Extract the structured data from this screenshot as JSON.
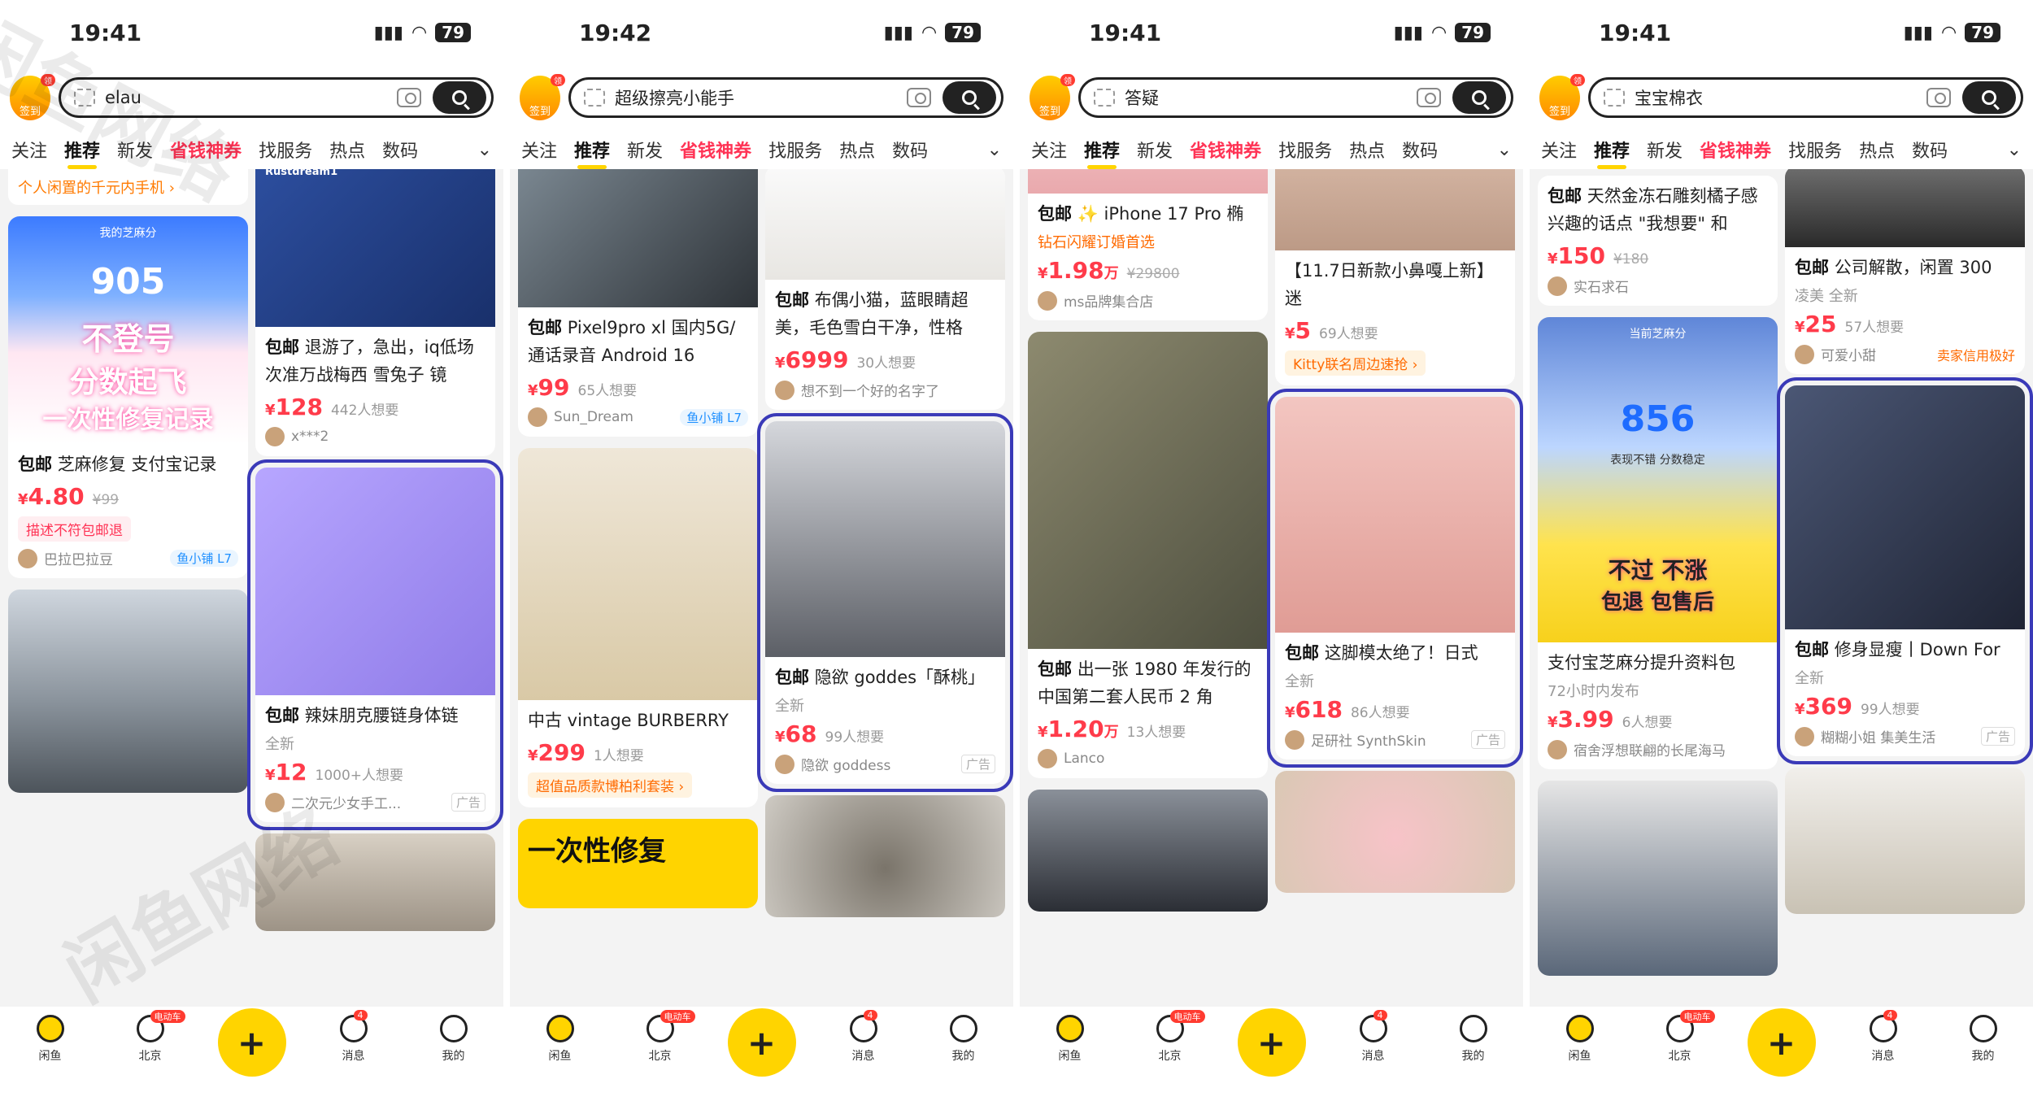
{
  "status": {
    "time": "19:41",
    "battery": "79"
  },
  "common": {
    "checkin_label": "签到",
    "checkin_badge": "领",
    "tabs": [
      "关注",
      "推荐",
      "新发",
      "省钱神券",
      "找服务",
      "热点",
      "数码"
    ],
    "nav": {
      "home": "闲鱼",
      "city": "北京",
      "city_badge": "电动车",
      "plus": "+",
      "messages": "消息",
      "messages_badge": "4",
      "mine": "我的"
    }
  },
  "watermark": "闲鱼网络",
  "phones": [
    {
      "time": "19:41",
      "search": "elau",
      "left": [
        {
          "banner": "个人闲置的千元内手机 ›"
        },
        {
          "img_text_1": "我的芝麻分",
          "img_score": "905",
          "img_overlay_1": "不登号",
          "img_overlay_2": "分数起飞",
          "img_overlay_3": "一次性修复记录",
          "tag": "包邮",
          "title": "芝麻修复 支付宝记录",
          "price": "4.80",
          "old": "¥99",
          "pill": "描述不符包邮退",
          "seller": "巴拉巴拉豆",
          "vip": "鱼小铺 L7"
        },
        {
          "img": "car"
        }
      ],
      "right": [
        {
          "img_text": "Rustdream1",
          "tag": "包邮",
          "title": "退游了，急出，iq低场次准万战梅西 雪兔子 镜",
          "price": "128",
          "want": "442人想要",
          "seller": "x***2"
        },
        {
          "img": "body",
          "tag": "包邮",
          "title": "辣妹朋克腰链身体链",
          "meta": "全新",
          "price": "12",
          "want": "1000+人想要",
          "seller": "二次元少女手工...",
          "ad": "广告",
          "hl": true
        },
        {
          "img": "bottle"
        }
      ]
    },
    {
      "time": "19:42",
      "search": "超级擦亮小能手",
      "left": [
        {
          "img": "phone",
          "tag": "包邮",
          "title": "Pixel9pro xl 国内5G/通话录音 Android 16",
          "price": "99",
          "want": "65人想要",
          "seller": "Sun_Dream",
          "vip": "鱼小铺 L7"
        },
        {
          "img": "coat",
          "title": "中古 vintage BURBERRY",
          "price": "299",
          "want": "1人想要",
          "pill": "超值品质款博柏利套装 ›"
        },
        {
          "img_text": "一次性修复"
        }
      ],
      "right": [
        {
          "img": "fur",
          "tag": "包邮",
          "title": "布偶小猫，蓝眼睛超美，毛色雪白干净，性格",
          "price": "6999",
          "want": "30人想要",
          "seller": "想不到一个好的名字了"
        },
        {
          "img": "girl",
          "tag": "包邮",
          "title": "隐欲 goddes「酥桃」",
          "meta": "全新",
          "price": "68",
          "want": "99人想要",
          "seller": "隐欲 goddess",
          "ad": "广告",
          "hl": true
        },
        {
          "img": "bowl"
        }
      ]
    },
    {
      "time": "19:41",
      "search": "答疑",
      "left": [
        {
          "img": "pink",
          "tag": "包邮",
          "title": "✨ iPhone 17 Pro 椭",
          "sub": "钻石闪耀订婚首选",
          "price": "1.98",
          "unit": "万",
          "old": "¥29800",
          "seller": "ms品牌集合店"
        },
        {
          "img": "money",
          "tag": "包邮",
          "title": "出一张 1980 年发行的中国第二套人民币 2 角",
          "price": "1.20",
          "unit": "万",
          "want": "13人想要",
          "seller": "Lanco"
        },
        {
          "img": "street"
        }
      ],
      "right": [
        {
          "img": "hand",
          "title": "【11.7日新款小鼻嘎上新】迷",
          "price": "5",
          "want": "69人想要",
          "pill": "Kitty联名周边速抢 ›"
        },
        {
          "img": "foot",
          "tag": "包邮",
          "title": "这脚模太绝了！日式",
          "meta": "全新",
          "price": "618",
          "want": "86人想要",
          "seller": "足研社 SynthSkin",
          "ad": "广告",
          "hl": true
        },
        {
          "img": "pig"
        }
      ]
    },
    {
      "time": "19:41",
      "search": "宝宝棉衣",
      "left": [
        {
          "tag": "包邮",
          "title": "天然金冻石雕刻橘子感兴趣的话点 \"我想要\" 和",
          "price": "150",
          "old": "¥180",
          "seller": "实石求石"
        },
        {
          "img": "blue",
          "img_score": "856",
          "img_text_1": "当前芝麻分",
          "img_text_2": "表现不错 分数稳定",
          "img_overlay_1": "不过 不涨",
          "img_overlay_2": "包退 包售后",
          "title": "支付宝芝麻分提升资料包",
          "sub": "72小时内发布",
          "price": "3.99",
          "want": "6人想要",
          "seller": "宿舍浮想联翩的长尾海马"
        },
        {
          "img": "moto"
        }
      ],
      "right": [
        {
          "img": "box",
          "tag": "包邮",
          "title": "公司解散，闲置 300",
          "meta": "凌美 全新",
          "price": "25",
          "want": "57人想要",
          "seller": "可爱小甜",
          "credit": "卖家信用极好"
        },
        {
          "img": "jacket",
          "tag": "包邮",
          "title": "修身显瘦丨Down For",
          "meta": "全新",
          "price": "369",
          "want": "99人想要",
          "seller": "糊糊小姐 集美生活",
          "ad": "广告",
          "hl": true
        },
        {
          "img": "shoes"
        }
      ]
    }
  ]
}
